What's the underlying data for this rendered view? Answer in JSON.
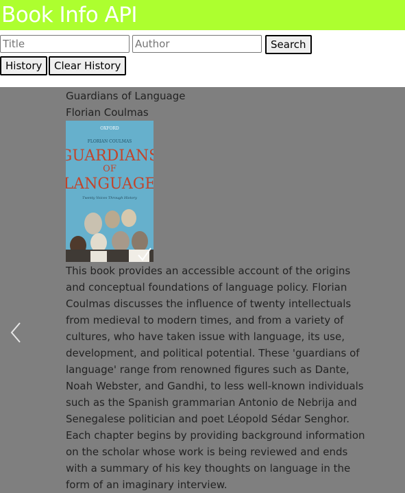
{
  "header": {
    "title": "Book Info API"
  },
  "search": {
    "title_placeholder": "Title",
    "author_placeholder": "Author",
    "search_label": "Search",
    "history_label": "History",
    "clear_history_label": "Clear History"
  },
  "book": {
    "title": "Guardians of Language",
    "author": "Florian Coulmas",
    "cover": {
      "publisher": "OXFORD",
      "author_line": "FLORIAN COULMAS",
      "title_line1": "GUARDIANS",
      "title_line2": "OF",
      "title_line3": "LANGUAGE",
      "subtitle": "Twenty Voices Through History"
    },
    "description": "This book provides an accessible account of the origins and conceptual foundations of language policy. Florian Coulmas discusses the influence of twenty intellectuals from medieval to modern times, and from a variety of cultures, who have taken issue with language, its use, development, and political potential. These 'guardians of language' range from renowned figures such as Dante, Noah Webster, and Gandhi, to less well-known individuals such as the Spanish grammarian Antonio de Nebrija and Senegalese politician and poet Léopold Sédar Senghor. Each chapter begins by providing background information on the scholar whose work is being reviewed and ends with a summary of his key thoughts on language in the form of an imaginary interview."
  },
  "colors": {
    "header_bg": "#adff2f",
    "overlay_bg": "#7f7f7f"
  },
  "icons": {
    "prev": "chevron-left-icon"
  }
}
